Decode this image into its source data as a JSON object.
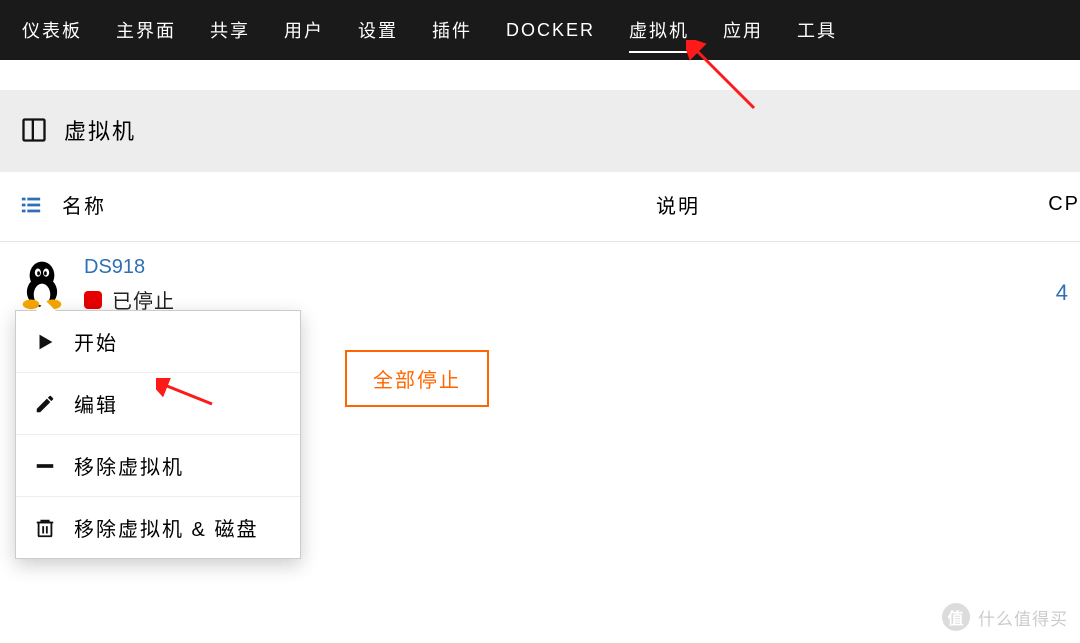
{
  "nav": {
    "items": [
      "仪表板",
      "主界面",
      "共享",
      "用户",
      "设置",
      "插件",
      "DOCKER",
      "虚拟机",
      "应用",
      "工具"
    ],
    "active_index": 7
  },
  "section": {
    "title": "虚拟机"
  },
  "columns": {
    "name": "名称",
    "desc": "说明",
    "cpu": "CP"
  },
  "vm": {
    "name": "DS918",
    "status": "已停止",
    "cpu_count": "4"
  },
  "context_menu": {
    "start": "开始",
    "edit": "编辑",
    "remove_vm": "移除虚拟机",
    "remove_vm_disk": "移除虚拟机 & 磁盘"
  },
  "buttons": {
    "stop_all": "全部停止"
  },
  "watermark": {
    "badge": "值",
    "text": "什么值得买"
  }
}
